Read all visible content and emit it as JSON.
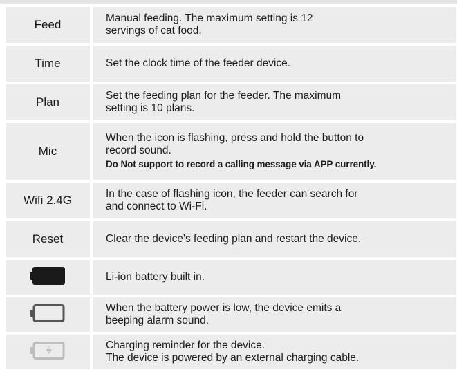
{
  "rows": [
    {
      "key": "feed",
      "label": "Feed",
      "lines": [
        "Manual feeding. The maximum setting is 12",
        "servings of cat food."
      ]
    },
    {
      "key": "time",
      "label": "Time",
      "lines": [
        "Set the clock time of the feeder device."
      ]
    },
    {
      "key": "plan",
      "label": "Plan",
      "lines": [
        "Set the feeding plan for the feeder. The maximum",
        "setting is 10 plans."
      ]
    },
    {
      "key": "mic",
      "label": "Mic",
      "lines": [
        "When the icon is flashing, press and hold the button to",
        "record sound."
      ],
      "note": "Do Not support to record a calling message via APP currently."
    },
    {
      "key": "wifi",
      "label": "Wifi 2.4G",
      "lines": [
        "In the case of flashing icon, the feeder can search for",
        "and connect to Wi-Fi."
      ]
    },
    {
      "key": "reset",
      "label": "Reset",
      "lines": [
        "Clear the device's feeding plan and restart the device."
      ]
    },
    {
      "key": "battery-full",
      "icon": "battery-full-icon",
      "lines": [
        "Li-ion battery built in."
      ]
    },
    {
      "key": "battery-low",
      "icon": "battery-empty-icon",
      "lines": [
        "When the battery power is low, the device emits a",
        "beeping alarm sound."
      ]
    },
    {
      "key": "battery-charging",
      "icon": "battery-charging-icon",
      "lines": [
        "Charging reminder for the device.",
        "The device is powered by an external charging cable."
      ]
    }
  ],
  "colors": {
    "cell_bg": "#ececec",
    "text": "#1e1e1e",
    "battery_full": "#1a1a1a",
    "battery_empty": "#555555",
    "battery_charging": "#bdbdbd"
  }
}
